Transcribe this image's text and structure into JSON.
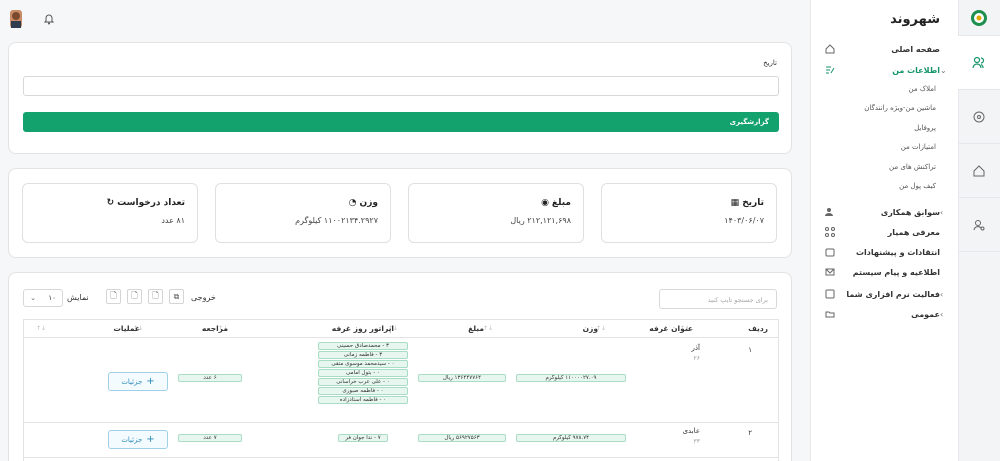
{
  "header": {
    "bell_icon": "bell-icon",
    "avatar": "user-avatar"
  },
  "sidebar": {
    "title": "شهروند",
    "items": [
      {
        "label": "صفحه اصلی",
        "icon": "home-icon",
        "chevron": ""
      },
      {
        "label": "اطلاعات من",
        "icon": "edit-list-icon",
        "chevron": "⌄"
      },
      {
        "label": "سوابق همکاری",
        "icon": "users-icon",
        "chevron": "›"
      },
      {
        "label": "معرفی همیار",
        "icon": "share-icon",
        "chevron": ""
      },
      {
        "label": "انتقادات و پیشنهادات",
        "icon": "inbox-icon",
        "chevron": ""
      },
      {
        "label": "اطلاعیه و پیام سیستم",
        "icon": "mail-icon",
        "chevron": ""
      },
      {
        "label": "فعالیت نرم افزاری شما",
        "icon": "activity-icon",
        "chevron": "›"
      },
      {
        "label": "عمومی",
        "icon": "folder-icon",
        "chevron": "›"
      }
    ],
    "sub_items": [
      "املاک من",
      "ماشین من-ویژه رانندگان",
      "پروفایل",
      "امتیازات من",
      "تراکنش های من",
      "کیف پول من"
    ]
  },
  "filter": {
    "date_label": "تاریخ",
    "date_value": "",
    "report_button": "گزارشگیری"
  },
  "stats": [
    {
      "title": "تاریخ",
      "value": "۱۴۰۳/۰۶/۰۷",
      "icon": "calendar-icon"
    },
    {
      "title": "مبلغ",
      "value": "۲۱۲,۱۲۱,۶۹۸ ریال",
      "icon": "coin-icon"
    },
    {
      "title": "وزن",
      "value": "۱۱۰۰۲۱۳۴.۲۹۲۷ کیلوگرم",
      "icon": "gauge-icon"
    },
    {
      "title": "تعداد درخواست",
      "value": "۸۱ عدد",
      "icon": "refresh-icon"
    }
  ],
  "table_controls": {
    "search_placeholder": "برای جستجو تایپ کنید",
    "output_label": "خروجی",
    "show_label": "نمایش",
    "page_size": "۱۰"
  },
  "columns": [
    "ردیف",
    "عنوان غرفه",
    "وزن",
    "مبلغ",
    "اپراتور روز غرفه",
    "مراجعه",
    "عملیات"
  ],
  "rows": [
    {
      "index": "۱",
      "booth_title": "آذر",
      "booth_code": "۲۶",
      "weight": "۱۱۰۰۰۰۲۷.۰۹ کیلوگرم",
      "amount": "۱۳۶۴۴۷۷۶۴ ریال",
      "operators": [
        "۳ - محمدصادق حسینی",
        "۳ - فاطمه زمانی",
        "۰ - سیدمحمد موسوی متقی",
        "۰ - بتول امامی",
        "۰ - علی عرب خراسانی",
        "۰ - فاطمه صبوری",
        "۰ - فاطمه استادزاده"
      ],
      "visits": "۶ عدد",
      "details": "جزئیات"
    },
    {
      "index": "۲",
      "booth_title": "عابدی",
      "booth_code": "۳۳",
      "weight": "۹۷۸.۷۴ کیلوگرم",
      "amount": "۵۶۹۲۷۵۶۳ ریال",
      "operators": [
        "۷ - ندا جوان فر"
      ],
      "visits": "۷ عدد",
      "details": "جزئیات"
    }
  ],
  "colors": {
    "accent": "#13a26e",
    "tag_bg": "#e7f7f0",
    "link": "#2a8ab8"
  }
}
